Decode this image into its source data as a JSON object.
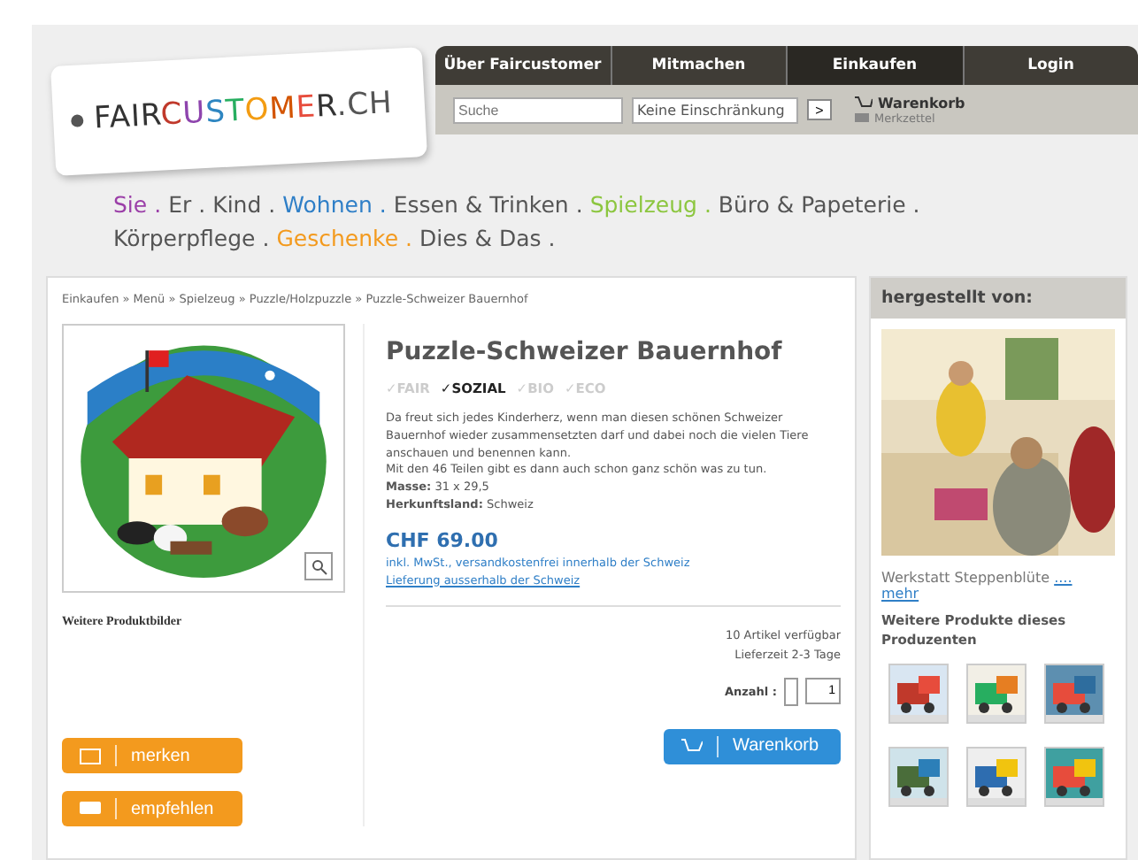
{
  "logo": {
    "parts": [
      {
        "text": "FAIR",
        "color": "#333333"
      },
      {
        "text": "C",
        "color": "#c0392b"
      },
      {
        "text": "U",
        "color": "#8e44ad"
      },
      {
        "text": "S",
        "color": "#2e86c1"
      },
      {
        "text": "T",
        "color": "#27ae60"
      },
      {
        "text": "O",
        "color": "#f39c12"
      },
      {
        "text": "M",
        "color": "#d35400"
      },
      {
        "text": "E",
        "color": "#e74c3c"
      },
      {
        "text": "R",
        "color": "#333333"
      },
      {
        "text": ".CH",
        "color": "#555555"
      }
    ]
  },
  "nav": [
    {
      "label": "Über Faircustomer",
      "selected": false
    },
    {
      "label": "Mitmachen",
      "selected": false
    },
    {
      "label": "Einkaufen",
      "selected": true
    },
    {
      "label": "Login",
      "selected": false
    }
  ],
  "search": {
    "placeholder": "Suche",
    "filter": "Keine Einschränkung",
    "go": ">"
  },
  "cart_links": {
    "cart": "Warenkorb",
    "notes": "Merkzettel"
  },
  "categories": {
    "separator": ".",
    "items": [
      {
        "label": "Sie",
        "color": "#9b3fa8"
      },
      {
        "label": "Er",
        "color": "#555555"
      },
      {
        "label": "Kind",
        "color": "#555555"
      },
      {
        "label": "Wohnen",
        "color": "#2f7fc7"
      },
      {
        "label": "Essen & Trinken",
        "color": "#555555"
      },
      {
        "label": "Spielzeug",
        "color": "#8cc63f"
      },
      {
        "label": "Büro & Papeterie",
        "color": "#555555"
      },
      {
        "label": "Körperpflege",
        "color": "#555555"
      },
      {
        "label": "Geschenke",
        "color": "#f39a1e"
      },
      {
        "label": "Dies & Das",
        "color": "#555555"
      }
    ]
  },
  "breadcrumb": [
    "Einkaufen",
    "Menü",
    "Spielzeug",
    "Puzzle/Holzpuzzle",
    "Puzzle-Schweizer Bauernhof"
  ],
  "breadcrumb_separator": "»",
  "more_images": "Weitere Produktbilder",
  "actions": [
    {
      "label": "merken",
      "kind": "note"
    },
    {
      "label": "empfehlen",
      "kind": "comment"
    }
  ],
  "product": {
    "title": "Puzzle-Schweizer Bauernhof",
    "labels": [
      {
        "label": "✓FAIR",
        "active": false
      },
      {
        "label": "✓SOZIAL",
        "active": true
      },
      {
        "label": "✓BIO",
        "active": false
      },
      {
        "label": "✓ECO",
        "active": false
      }
    ],
    "description": "Da freut sich jedes Kinderherz, wenn man diesen schönen Schweizer Bauernhof wieder zusammensetzten darf und dabei noch die vielen Tiere anschauen und benennen kann.",
    "description_2": "Mit den 46 Teilen gibt es dann auch schon ganz schön was zu tun.",
    "facts": [
      {
        "name": "Masse:",
        "value": "31 x 29,5"
      },
      {
        "name": "Herkunftsland:",
        "value": "Schweiz"
      }
    ],
    "price": "CHF 69.00",
    "price_note": "inkl. MwSt., versandkostenfrei innerhalb der Schweiz",
    "shipping_link": "Lieferung ausserhalb der Schweiz",
    "stock": "10 Artikel verfügbar",
    "delivery": "Lieferzeit 2-3 Tage",
    "quantity_label": "Anzahl :",
    "quantity": "1",
    "cart_button": "Warenkorb"
  },
  "sidebar": {
    "title": "hergestellt von:",
    "producer": "Werkstatt Steppenblüte",
    "more": "....",
    "more_link": "mehr",
    "other_title": "Weitere Produkte dieses Produzenten"
  }
}
